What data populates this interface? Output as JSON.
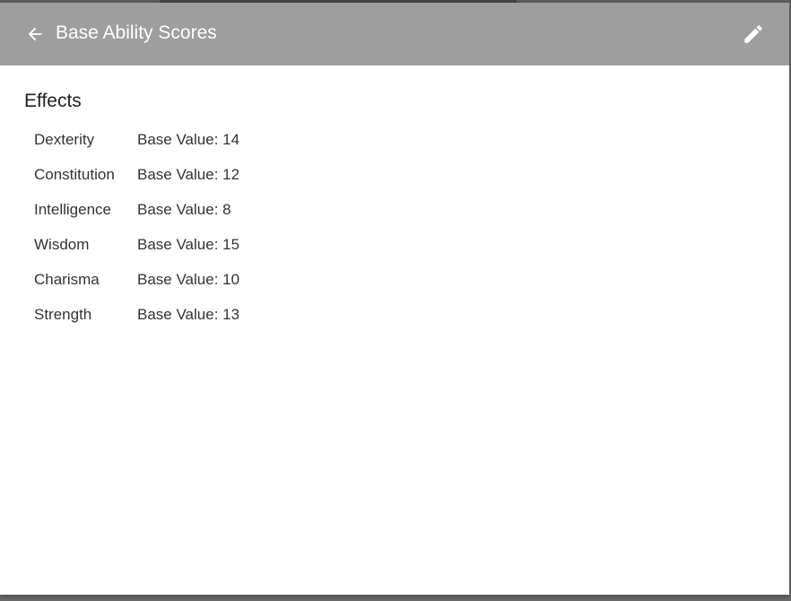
{
  "toolbar": {
    "title": "Base Ability Scores",
    "back_icon": "arrow-left-icon",
    "edit_icon": "pencil-icon"
  },
  "effects": {
    "heading": "Effects",
    "rows": [
      {
        "name": "Dexterity",
        "value": "Base Value: 14"
      },
      {
        "name": "Constitution",
        "value": "Base Value: 12"
      },
      {
        "name": "Intelligence",
        "value": "Base Value: 8"
      },
      {
        "name": "Wisdom",
        "value": "Base Value: 15"
      },
      {
        "name": "Charisma",
        "value": "Base Value: 10"
      },
      {
        "name": "Strength",
        "value": "Base Value: 13"
      }
    ]
  },
  "colors": {
    "toolbar_bg": "#9e9e9e",
    "toolbar_fg": "#ffffff",
    "text": "#333333"
  }
}
